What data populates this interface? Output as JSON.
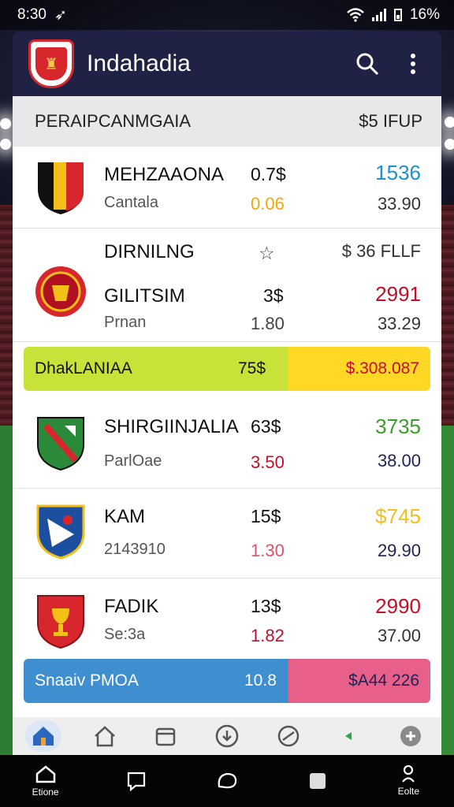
{
  "status_bar": {
    "time": "8:30",
    "battery": "16%"
  },
  "app": {
    "title": "Indahadia"
  },
  "section": {
    "left": "PERAIPCANMGAIA",
    "right": "$5 IFUP"
  },
  "rows": [
    {
      "team": "MEHZAAONA",
      "sub": "Cantala",
      "pct": "0.7$",
      "odd": "0.06",
      "right_top": "1536",
      "right_bottom": "33.90"
    },
    {
      "header_left": "DIRNILNG",
      "header_mid": "☆",
      "header_right": "$ 36 FLLF",
      "team": "GILITSIM",
      "sub": "Prnan",
      "pct": "3$",
      "odd": "1.80",
      "right_top": "2991",
      "right_bottom": "33.29"
    },
    {
      "team": "SHIRGIINJALIA",
      "sub": "ParlOae",
      "pct": "63$",
      "odd": "3.50",
      "right_top": "3735",
      "right_bottom": "38.00"
    },
    {
      "team": "KAM",
      "sub": "2143910",
      "pct": "15$",
      "odd": "1.30",
      "right_top": "$745",
      "right_bottom": "29.90"
    },
    {
      "team": "FADIK",
      "sub": "Se:3a",
      "pct": "13$",
      "odd": "1.82",
      "right_top": "2990",
      "right_bottom": "37.00"
    }
  ],
  "banners": [
    {
      "label": "DhakLANIAA",
      "pct": "75$",
      "value": "$.308.087"
    },
    {
      "label": "Snaaiv PMOA",
      "pct": "10.8",
      "value": "$A44 226"
    }
  ],
  "navbar": {
    "left_label": "Etione",
    "right_label": "Eolte"
  },
  "colors": {
    "appbar": "#1f2145",
    "blue": "#1e90d0",
    "orange": "#f0a80a",
    "crimson": "#c0102a",
    "green": "#3a9e2a",
    "navy": "#1e2255",
    "yellow": "#f0c020",
    "lime": "#c9e23a",
    "banner_yellow": "#ffd825",
    "banner_blue": "#3f8fd0",
    "banner_pink": "#e8608a"
  },
  "icons": [
    "wifi-icon",
    "signal-icon",
    "battery-icon",
    "search-icon",
    "more-vert-icon",
    "home-icon",
    "calendar-icon",
    "download-icon",
    "target-icon",
    "settings-icon"
  ]
}
